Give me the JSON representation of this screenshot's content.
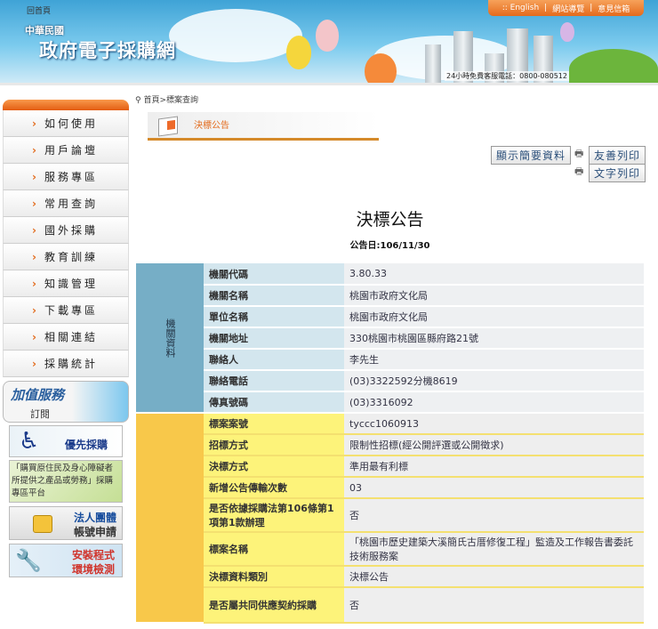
{
  "header": {
    "home_link": "回首頁",
    "country": "中華民國",
    "site_title": "政府電子採購網",
    "top_links": [
      ":: English",
      "網站導覽",
      "意見信箱"
    ],
    "hotline": "24小時免費客服電話：0800-080512"
  },
  "sidebar": {
    "menu": [
      "如何使用",
      "用戶論壇",
      "服務專區",
      "常用查詢",
      "國外採購",
      "教育訓練",
      "知識管理",
      "下載專區",
      "相關連結",
      "採購統計"
    ],
    "banners": {
      "value_added": [
        "加值服務",
        "訂閱"
      ],
      "priority": "優先採購",
      "indigenous": "「購買原住民及身心障礙者所提供之產品或勞務」採購專區平台",
      "legal_entity": [
        "法人團體",
        "帳號申請"
      ],
      "install": [
        "安裝程式",
        "環境檢測"
      ]
    }
  },
  "breadcrumb": "首頁>標案查詢",
  "section_title": "決標公告",
  "buttons": {
    "summary": "顯示簡要資料",
    "friendly_print": "友善列印",
    "text_print": "文字列印"
  },
  "page_heading": "決標公告",
  "pub_date": "公告日:106/11/30",
  "agency": {
    "group_label": "機關資料",
    "rows": [
      {
        "label": "機關代碼",
        "value": "3.80.33"
      },
      {
        "label": "機關名稱",
        "value": "桃園市政府文化局"
      },
      {
        "label": "單位名稱",
        "value": "桃園市政府文化局"
      },
      {
        "label": "機關地址",
        "value": "330桃園市桃園區縣府路21號"
      },
      {
        "label": "聯絡人",
        "value": "李先生"
      },
      {
        "label": "聯絡電話",
        "value": "(03)3322592分機8619"
      },
      {
        "label": "傳真號碼",
        "value": "(03)3316092"
      }
    ]
  },
  "award": {
    "rows": [
      {
        "label": "標案案號",
        "value": "tyccc1060913"
      },
      {
        "label": "招標方式",
        "value": "限制性招標(經公開評選或公開徵求)"
      },
      {
        "label": "決標方式",
        "value": "準用最有利標"
      },
      {
        "label": "新增公告傳輸次數",
        "value": "03"
      },
      {
        "label": "是否依據採購法第106條第1項第1款辦理",
        "value": "否"
      },
      {
        "label": "標案名稱",
        "value": "「桃園市歷史建築大溪簡氏古厝修復工程」監造及工作報告書委託技術服務案"
      },
      {
        "label": "決標資料類別",
        "value": "決標公告"
      },
      {
        "label": "是否屬共同供應契約採購",
        "value": "否"
      }
    ]
  }
}
